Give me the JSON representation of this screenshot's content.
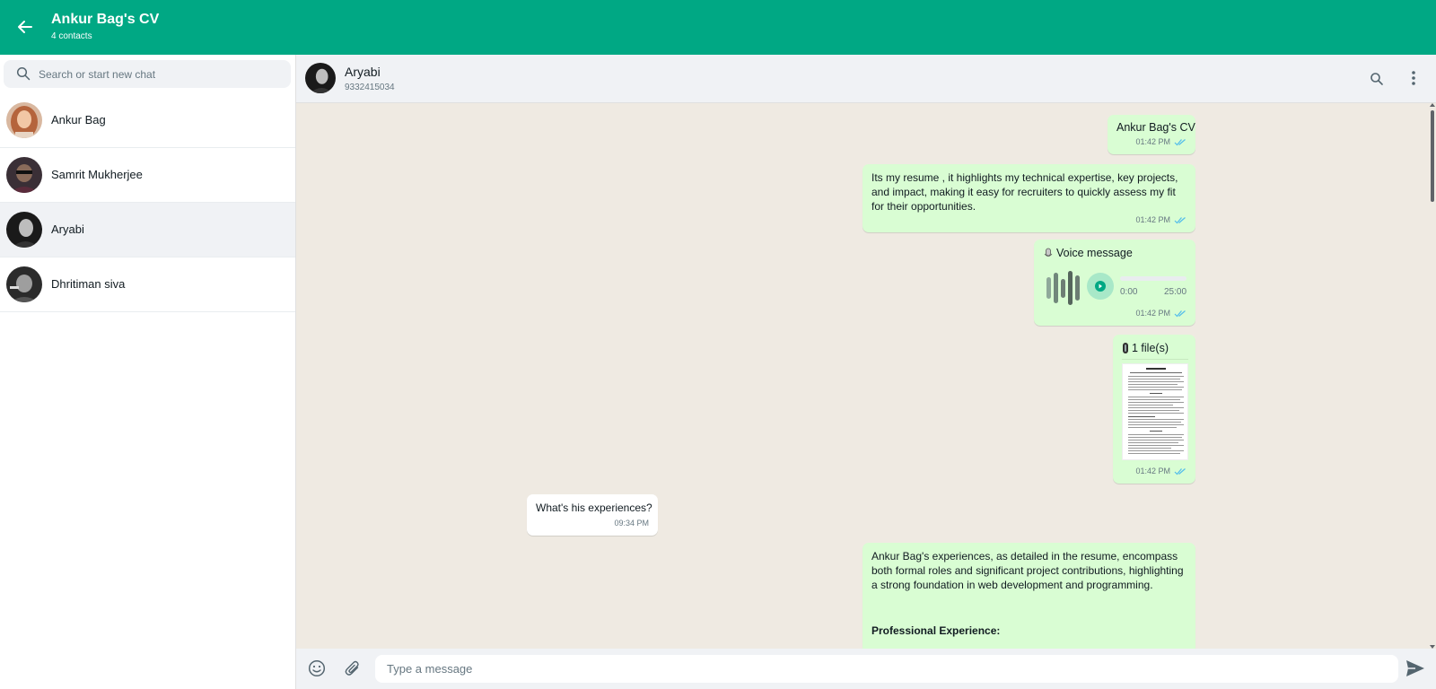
{
  "colors": {
    "brand": "#00a884",
    "outgoing_bubble": "#d9fdd3",
    "incoming_bubble": "#ffffff",
    "chat_background": "#efeae2",
    "read_ticks": "#53bdeb"
  },
  "header": {
    "title": "Ankur Bag's CV",
    "subtitle": "4 contacts",
    "back_icon": "arrow-left-icon"
  },
  "sidebar": {
    "search": {
      "placeholder": "Search or start new chat",
      "value": "",
      "icon": "search-icon"
    },
    "contacts": [
      {
        "name": "Ankur Bag",
        "active": false
      },
      {
        "name": "Samrit Mukherjee",
        "active": false
      },
      {
        "name": "Aryabi",
        "active": true
      },
      {
        "name": "Dhritiman siva",
        "active": false
      }
    ]
  },
  "chat": {
    "contact_name": "Aryabi",
    "contact_phone": "9332415034",
    "icons": [
      "search-icon",
      "kebab-menu-icon"
    ],
    "messages": [
      {
        "direction": "out",
        "text": "Ankur Bag's CV",
        "time": "01:42 PM",
        "status": "read"
      },
      {
        "direction": "out",
        "text": "Its my resume , it highlights my technical expertise, key projects, and impact, making it easy for recruiters to quickly assess my fit for their opportunities.",
        "time": "01:42 PM",
        "status": "read"
      },
      {
        "direction": "out",
        "type": "voice",
        "title": "Voice message",
        "title_icon": "microphone-icon",
        "current_time": "0:00",
        "duration": "25:00",
        "progress": 0,
        "time": "01:42 PM",
        "status": "read"
      },
      {
        "direction": "out",
        "type": "file",
        "title": "1 file(s)",
        "title_icon": "paperclip-icon",
        "time": "01:42 PM",
        "status": "read"
      },
      {
        "direction": "in",
        "text": "What's his experiences?",
        "time": "09:34 PM"
      },
      {
        "direction": "out",
        "text": "Ankur Bag's experiences, as detailed in the resume, encompass both formal roles and significant project contributions, highlighting a strong foundation in web development and programming.",
        "subheading": "Professional Experience:"
      }
    ]
  },
  "composer": {
    "placeholder": "Type a message",
    "value": "",
    "icons": [
      "emoji-icon",
      "paperclip-icon",
      "send-icon"
    ]
  }
}
